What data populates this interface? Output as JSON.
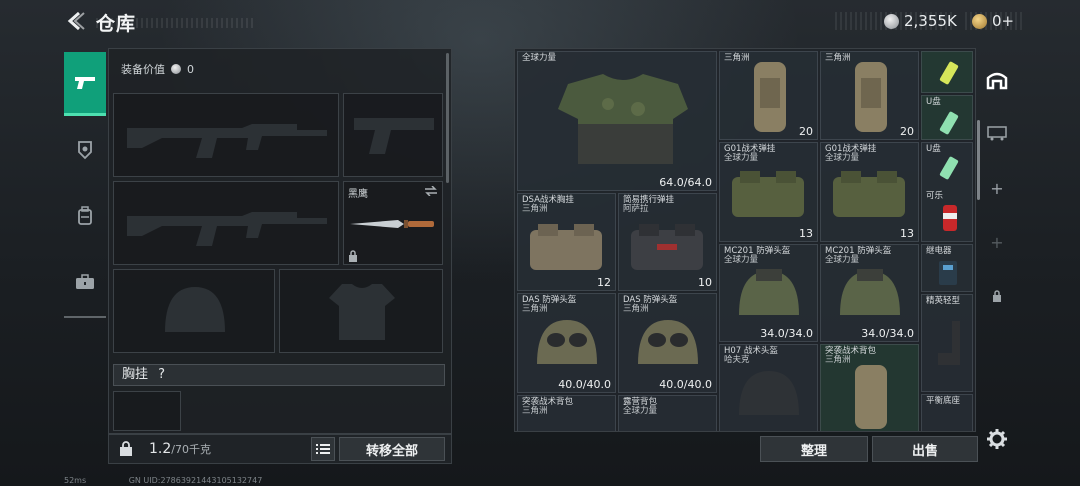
{
  "header": {
    "title": "仓库",
    "currency_silver": "2,355K",
    "currency_gold": "0+"
  },
  "equipment": {
    "value_label": "装备价值",
    "value": "0",
    "melee_label": "黑鹰",
    "vest_label": "胸挂",
    "vest_help": "?"
  },
  "bottom": {
    "weight": "1.2",
    "weight_max": "/70千克",
    "transfer_all": "转移全部",
    "sort": "整理",
    "sell": "出售"
  },
  "inventory": {
    "items": [
      {
        "name": "全球力量",
        "sub": "",
        "value": "64.0/64.0",
        "tl": ""
      },
      {
        "name": "三角洲",
        "sub": "",
        "value": "20",
        "tl": ""
      },
      {
        "name": "三角洲",
        "sub": "",
        "value": "20",
        "tl": ""
      },
      {
        "name": "",
        "sub": "",
        "value": "",
        "tl": ""
      },
      {
        "name": "U盘",
        "sub": "",
        "value": "",
        "tl": ""
      },
      {
        "name": "U盘",
        "sub": "",
        "value": "",
        "tl": ""
      },
      {
        "name": "G01战术弹挂",
        "sub": "全球力量",
        "value": "13",
        "tl": ""
      },
      {
        "name": "G01战术弹挂",
        "sub": "全球力量",
        "value": "13",
        "tl": ""
      },
      {
        "name": "可乐",
        "sub": "",
        "value": "",
        "tl": ""
      },
      {
        "name": "DSA战术胸挂",
        "sub": "三角洲",
        "value": "12",
        "tl": ""
      },
      {
        "name": "简易携行弹挂",
        "sub": "阿萨拉",
        "value": "10",
        "tl": ""
      },
      {
        "name": "MC201 防弹头盔",
        "sub": "全球力量",
        "value": "34.0/34.0",
        "tl": ""
      },
      {
        "name": "MC201 防弹头盔",
        "sub": "全球力量",
        "value": "34.0/34.0",
        "tl": ""
      },
      {
        "name": "继电器",
        "sub": "",
        "value": "",
        "tl": ""
      },
      {
        "name": "DAS 防弹头盔",
        "sub": "三角洲",
        "value": "40.0/40.0",
        "tl": ""
      },
      {
        "name": "DAS 防弹头盔",
        "sub": "三角洲",
        "value": "40.0/40.0",
        "tl": ""
      },
      {
        "name": "精英轻型",
        "sub": "",
        "value": "",
        "tl": ""
      },
      {
        "name": "H07 战术头盔",
        "sub": "哈夫克",
        "value": "",
        "tl": ""
      },
      {
        "name": "突袭战术背包",
        "sub": "三角洲",
        "value": "",
        "tl": ""
      },
      {
        "name": "平衡底座",
        "sub": "",
        "value": "",
        "tl": ""
      },
      {
        "name": "突袭战术背包",
        "sub": "三角洲",
        "value": "",
        "tl": ""
      },
      {
        "name": "露营背包",
        "sub": "全球力量",
        "value": "",
        "tl": ""
      }
    ]
  },
  "footer": {
    "ping": "52ms",
    "uid": "GN UID:27863921443105132747"
  },
  "colors": {
    "accent": "#10a07a",
    "panel": "#1e2226"
  },
  "icons": [
    "back-arrow-icon",
    "silver-coin-icon",
    "gold-coin-icon",
    "pistol-icon",
    "medal-icon",
    "backpack-icon",
    "briefcase-icon",
    "lock-icon",
    "swap-icon",
    "list-icon",
    "gear-icon",
    "helmet-icon",
    "shield-icon"
  ]
}
